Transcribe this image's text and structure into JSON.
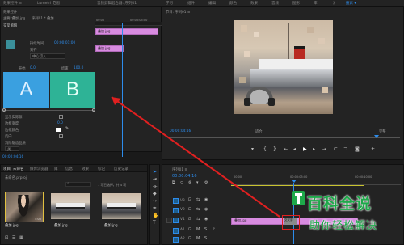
{
  "topbar": {
    "items_left": [
      "效果控件 ≡",
      "Lumetri 范围",
      "音频剪辑混合器: 序列01"
    ],
    "items_right": [
      "学习",
      "组件",
      "编辑",
      "颜色",
      "效果",
      "音频",
      "图形",
      "库",
      "》"
    ],
    "search_hint": "搜索 ▾"
  },
  "effect_controls": {
    "title": "效果控件",
    "source_line": "主要*叠加.jpg",
    "sequence_label": "序列01 * 叠加",
    "transition_name": "交叉溶解",
    "duration_label": "持续时间",
    "duration_value": "00:00:01:00",
    "alignment_label": "对齐",
    "alignment_value": "中心切入",
    "start_label": "开始",
    "start_value": "0.0",
    "end_label": "结束",
    "end_value": "100.0",
    "letter_a": "A",
    "letter_b": "B",
    "props": [
      "显示实际源",
      "边框宽度",
      "边框颜色",
      "反向",
      "消除锯齿品质"
    ],
    "border_value": "0.0",
    "aa_value": "关"
  },
  "mini_timeline": {
    "clip1": "叠加.jpg",
    "clip2": "叠加.jpg",
    "timecode_left": "00:00",
    "timecode_right": "00:00:05:00"
  },
  "status": {
    "timecode": "00:00:04:16"
  },
  "project_panel": {
    "tabs": [
      "项目: 未命名",
      "媒体浏览器",
      "库",
      "信息",
      "效果",
      "标记",
      "历史记录"
    ],
    "project_file": "未命名.prproj",
    "item_count": "1 项已选择，共 4 项",
    "thumbs": [
      {
        "name": "叠加.jpg",
        "dur": "5:00"
      },
      {
        "name": "叠加.jpg",
        "dur": ""
      },
      {
        "name": "叠加.jpg",
        "dur": ""
      }
    ]
  },
  "program_monitor": {
    "title": "节目: 序列01 ≡",
    "timecode": "00:00:04:16",
    "fit_label": "适合",
    "quality_label": "完整"
  },
  "timeline": {
    "title": "序列01 ≡",
    "timecode": "00:00:04:16",
    "ruler_marks": [
      "00:00",
      "00:00:05:00",
      "00:00:10:00"
    ],
    "tracks": [
      "V3",
      "V2",
      "V1",
      "A1",
      "A2"
    ],
    "clip_label": "叠加.jpg",
    "transition_label": "交叉溶"
  },
  "watermark": {
    "brand_text": "百科全说",
    "tagline": "助你轻松解决"
  },
  "colors": {
    "accent": "#2d8ceb",
    "clip": "#d88be0",
    "a_block": "#3aa0e0",
    "b_block": "#2eb396",
    "watermark_green": "#1ea94a",
    "arrow_red": "#e02020"
  }
}
